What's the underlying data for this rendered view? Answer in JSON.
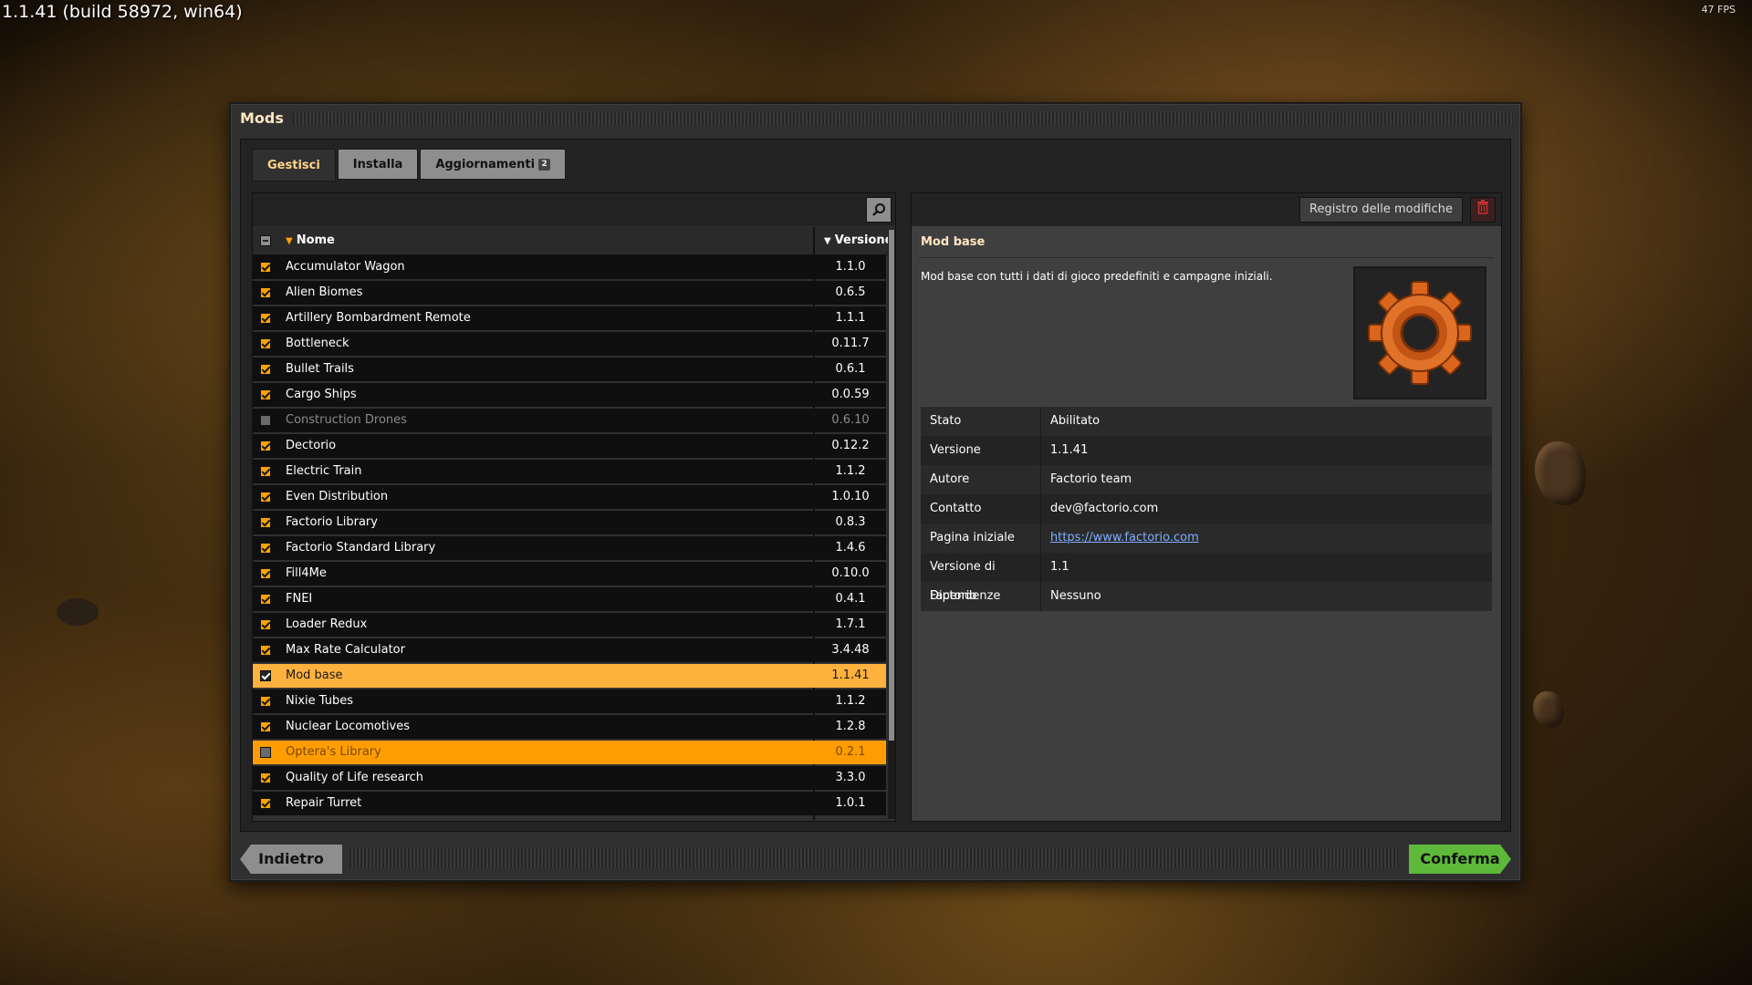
{
  "build_text": "1.1.41 (build 58972, win64)",
  "fps": "47 FPS",
  "window": {
    "title": "Mods"
  },
  "tabs": [
    {
      "label": "Gestisci",
      "active": true
    },
    {
      "label": "Installa",
      "active": false
    },
    {
      "label": "Aggiornamenti",
      "badge": "2",
      "active": false
    }
  ],
  "list": {
    "search_icon": "magnifier-icon",
    "header": {
      "name": "Nome",
      "version": "Versione"
    },
    "rows": [
      {
        "name": "Accumulator Wagon",
        "version": "1.1.0",
        "enabled": true
      },
      {
        "name": "Alien Biomes",
        "version": "0.6.5",
        "enabled": true
      },
      {
        "name": "Artillery Bombardment Remote",
        "version": "1.1.1",
        "enabled": true
      },
      {
        "name": "Bottleneck",
        "version": "0.11.7",
        "enabled": true
      },
      {
        "name": "Bullet Trails",
        "version": "0.6.1",
        "enabled": true
      },
      {
        "name": "Cargo Ships",
        "version": "0.0.59",
        "enabled": true
      },
      {
        "name": "Construction Drones",
        "version": "0.6.10",
        "enabled": false
      },
      {
        "name": "Dectorio",
        "version": "0.12.2",
        "enabled": true
      },
      {
        "name": "Electric Train",
        "version": "1.1.2",
        "enabled": true
      },
      {
        "name": "Even Distribution",
        "version": "1.0.10",
        "enabled": true
      },
      {
        "name": "Factorio Library",
        "version": "0.8.3",
        "enabled": true
      },
      {
        "name": "Factorio Standard Library",
        "version": "1.4.6",
        "enabled": true
      },
      {
        "name": "Fill4Me",
        "version": "0.10.0",
        "enabled": true
      },
      {
        "name": "FNEI",
        "version": "0.4.1",
        "enabled": true
      },
      {
        "name": "Loader Redux",
        "version": "1.7.1",
        "enabled": true
      },
      {
        "name": "Max Rate Calculator",
        "version": "3.4.48",
        "enabled": true
      },
      {
        "name": "Mod base",
        "version": "1.1.41",
        "enabled": true,
        "selected": true
      },
      {
        "name": "Nixie Tubes",
        "version": "1.1.2",
        "enabled": true
      },
      {
        "name": "Nuclear Locomotives",
        "version": "1.2.8",
        "enabled": true
      },
      {
        "name": "Optera's Library",
        "version": "0.2.1",
        "enabled": false,
        "hovered": true
      },
      {
        "name": "Quality of Life research",
        "version": "3.3.0",
        "enabled": true
      },
      {
        "name": "Repair Turret",
        "version": "1.0.1",
        "enabled": true
      }
    ]
  },
  "detail": {
    "changelog_label": "Registro delle modifiche",
    "delete_icon": "trash-icon",
    "title": "Mod base",
    "description": "Mod base con tutti i dati di gioco predefiniti e campagne iniziali.",
    "thumbnail_icon": "gear-icon",
    "info": [
      {
        "key": "Stato",
        "value": "Abilitato"
      },
      {
        "key": "Versione",
        "value": "1.1.41"
      },
      {
        "key": "Autore",
        "value": "Factorio team"
      },
      {
        "key": "Contatto",
        "value": "dev@factorio.com"
      },
      {
        "key": "Pagina iniziale",
        "value": "https://www.factorio.com",
        "link": true
      },
      {
        "key": "Versione di Factorio",
        "value": "1.1"
      },
      {
        "key": "Dipendenze",
        "value": "Nessuno"
      }
    ]
  },
  "buttons": {
    "back": "Indietro",
    "confirm": "Conferma"
  },
  "colors": {
    "accent": "#ffa200",
    "confirm": "#5eb83a",
    "link": "#7fb0ff"
  }
}
